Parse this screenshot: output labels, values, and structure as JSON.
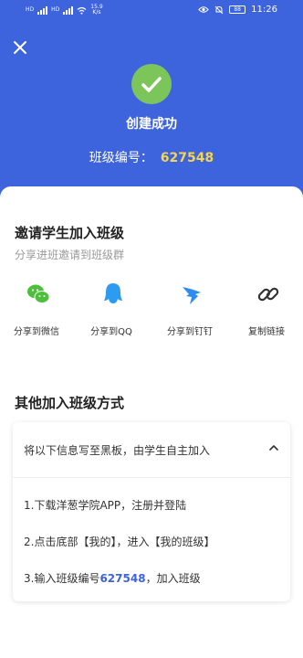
{
  "status_bar": {
    "network_tag_1": "HD",
    "network_tag_2": "HD",
    "speed_value": "15.9",
    "speed_unit": "K/s",
    "battery": "88",
    "time": "11:26"
  },
  "header": {
    "title": "创建成功",
    "class_code_label": "班级编号：",
    "class_code": "627548"
  },
  "invite": {
    "title": "邀请学生加入班级",
    "subtitle": "分享进班邀请到班级群",
    "share_options": [
      {
        "label": "分享到微信",
        "icon": "wechat-icon",
        "color": "#4cbf3b"
      },
      {
        "label": "分享到QQ",
        "icon": "qq-icon",
        "color": "#2d9cf0"
      },
      {
        "label": "分享到钉钉",
        "icon": "dingtalk-icon",
        "color": "#2d8cf0"
      },
      {
        "label": "复制链接",
        "icon": "link-icon",
        "color": "#333333"
      }
    ]
  },
  "other_methods": {
    "title": "其他加入班级方式",
    "header": "将以下信息写至黑板，由学生自主加入",
    "step_1": "1.下载洋葱学院APP，注册并登陆",
    "step_2": "2.点击底部【我的】，进入【我的班级】",
    "step_3_prefix": "3.输入班级编号",
    "step_3_code": "627548",
    "step_3_suffix": "，加入班级"
  },
  "colors": {
    "primary": "#3d63dd",
    "success": "#7cc55b",
    "code_highlight": "#f7d54a"
  }
}
